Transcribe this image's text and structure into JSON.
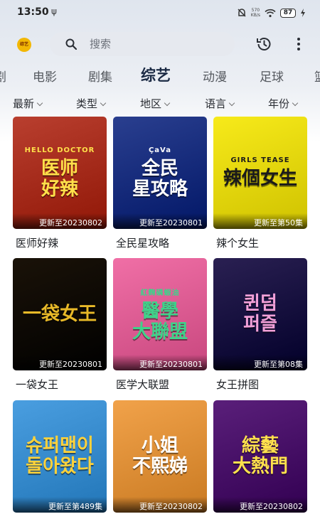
{
  "status": {
    "time": "13:50",
    "usb": "ψ",
    "net_speed_value": "570",
    "net_speed_unit": "KB/s",
    "battery": "87"
  },
  "topbar": {
    "logo_text": "综艺",
    "search_placeholder": "搜索"
  },
  "tabs": [
    {
      "label": "剧"
    },
    {
      "label": "电影"
    },
    {
      "label": "剧集"
    },
    {
      "label": "综艺"
    },
    {
      "label": "动漫"
    },
    {
      "label": "足球"
    },
    {
      "label": "篮"
    }
  ],
  "active_tab_index": 3,
  "filters": [
    {
      "label": "最新"
    },
    {
      "label": "类型"
    },
    {
      "label": "地区"
    },
    {
      "label": "语言"
    },
    {
      "label": "年份"
    }
  ],
  "cards": [
    {
      "title": "医师好辣",
      "update": "更新至20230802",
      "art": "医师\n好辣",
      "art_top": "HELLO DOCTOR",
      "bg": "#b93f2f",
      "accent": "#ffe04a"
    },
    {
      "title": "全民星攻略",
      "update": "更新至20230801",
      "art": "全民\n星攻略",
      "art_top": "ÇaVa",
      "bg": "#2a3f8f",
      "accent": "#ffffff"
    },
    {
      "title": "辣个女生",
      "update": "更新至第50集",
      "art": "辣個女生",
      "art_top": "GIRLS TEASE",
      "bg": "#f7ea1a",
      "accent": "#1a1a1a"
    },
    {
      "title": "一袋女王",
      "update": "更新至20230801",
      "art": "一袋女王",
      "art_top": "",
      "bg": "#1a1208",
      "accent": "#e8b928"
    },
    {
      "title": "医学大联盟",
      "update": "更新至20230801",
      "art": "醫學\n大聯盟",
      "art_top": "紅麴磷蝦油",
      "bg": "#f06fa6",
      "accent": "#3fd28a"
    },
    {
      "title": "女王拼图",
      "update": "更新至第08集",
      "art": "퀸덤\n퍼즐",
      "art_top": "",
      "bg": "#2a2052",
      "accent": "#f2a0d8"
    },
    {
      "title": "",
      "update": "更新至第489集",
      "art": "슈퍼맨이\n돌아왔다",
      "art_top": "",
      "bg": "#4a9ee0",
      "accent": "#ffd23a"
    },
    {
      "title": "",
      "update": "更新至20230802",
      "art": "小姐\n不熙娣",
      "art_top": "",
      "bg": "#f1a24a",
      "accent": "#ffffff"
    },
    {
      "title": "",
      "update": "更新至20230802",
      "art": "綜藝\n大熱門",
      "art_top": "",
      "bg": "#5a1f7a",
      "accent": "#ffe14d"
    }
  ]
}
